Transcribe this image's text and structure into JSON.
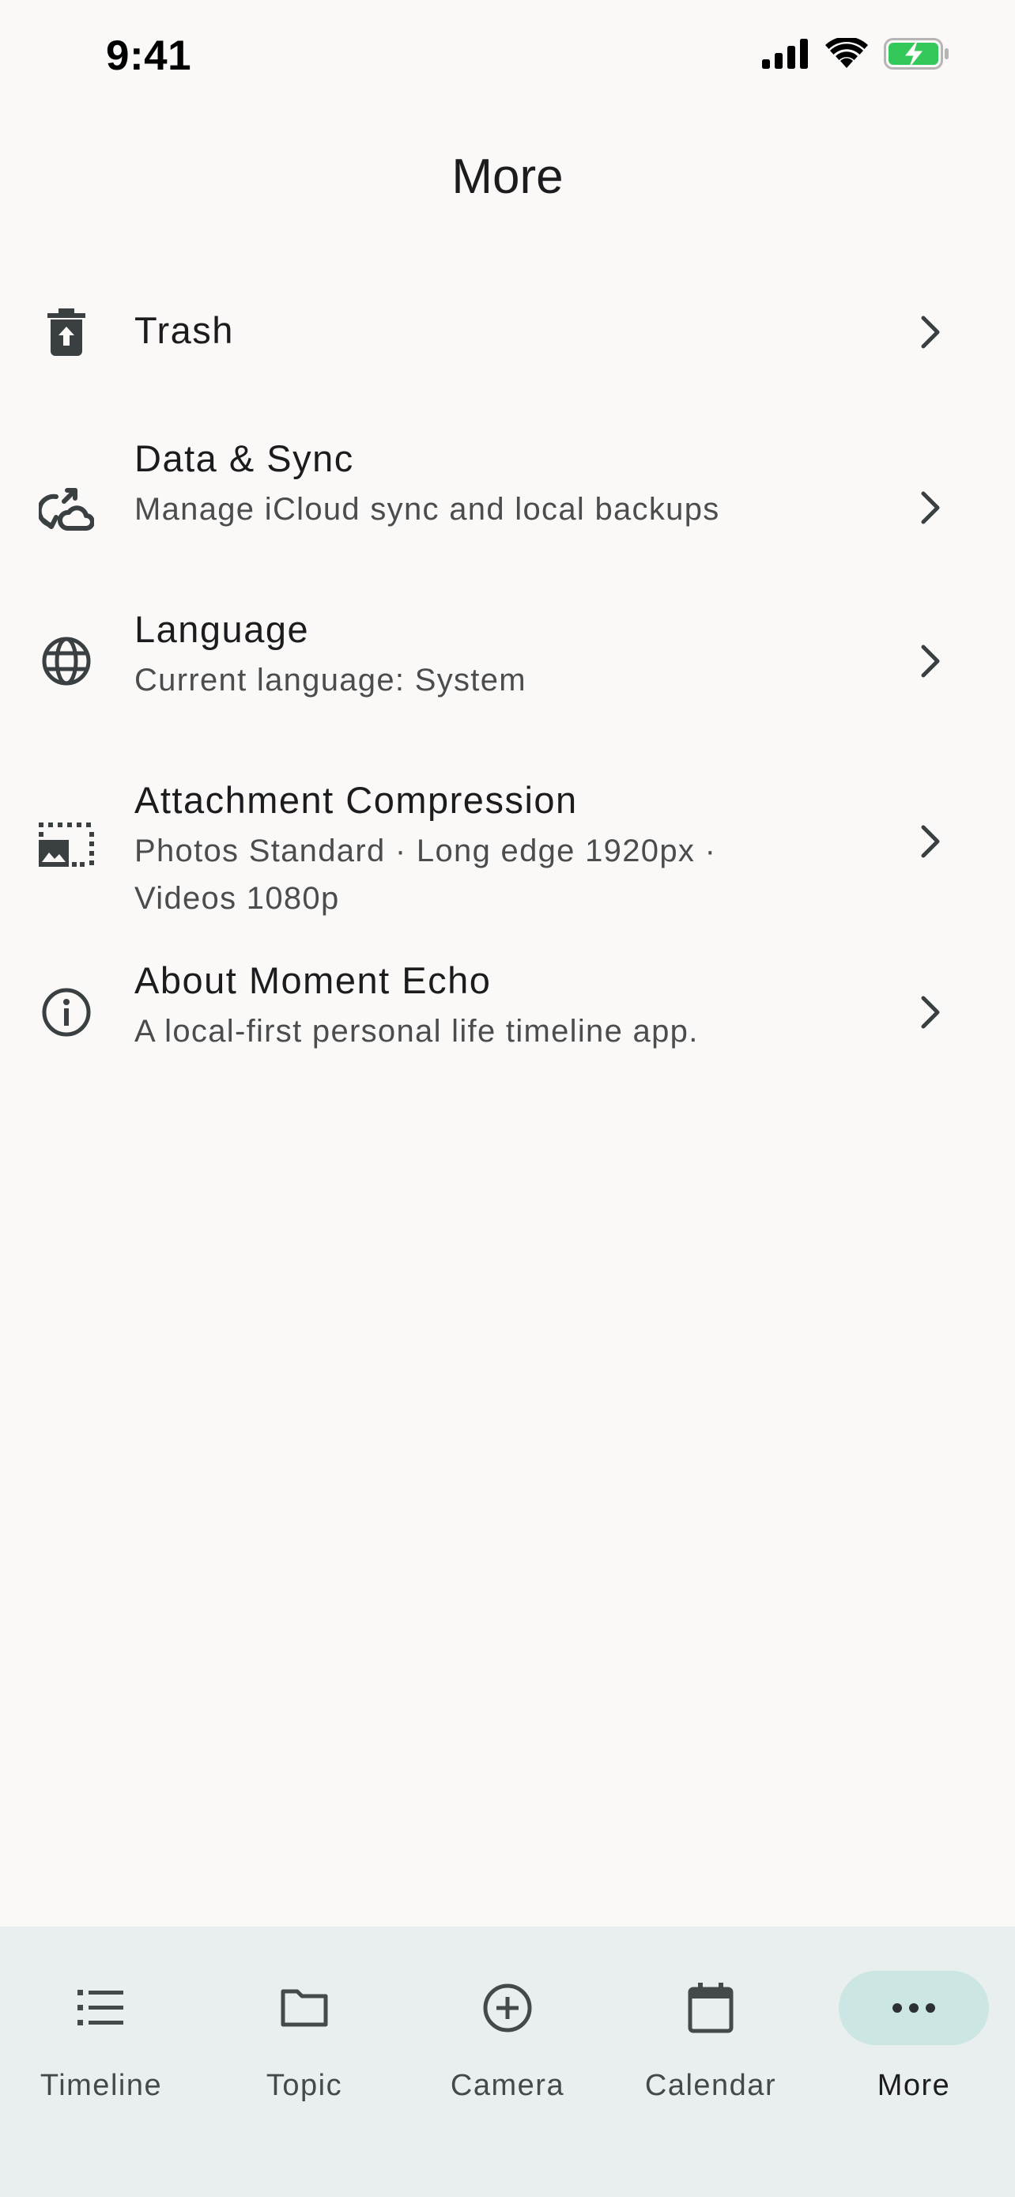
{
  "status_bar": {
    "time": "9:41"
  },
  "header": {
    "title": "More"
  },
  "menu": [
    {
      "title": "Trash",
      "subtitle": "",
      "icon": "trash-restore-icon"
    },
    {
      "title": "Data & Sync",
      "subtitle": "Manage iCloud sync and local backups",
      "icon": "sync-cloud-icon"
    },
    {
      "title": "Language",
      "subtitle": "Current language: System",
      "icon": "globe-icon"
    },
    {
      "title": "Attachment Compression",
      "subtitle": "Photos Standard · Long edge 1920px · Videos 1080p",
      "icon": "photo-size-select-icon"
    },
    {
      "title": "About Moment Echo",
      "subtitle": "A local-first personal life timeline app.",
      "icon": "info-icon"
    }
  ],
  "tabs": [
    {
      "label": "Timeline",
      "icon": "list-icon",
      "active": false
    },
    {
      "label": "Topic",
      "icon": "folder-icon",
      "active": false
    },
    {
      "label": "Camera",
      "icon": "add-circle-icon",
      "active": false
    },
    {
      "label": "Calendar",
      "icon": "calendar-icon",
      "active": false
    },
    {
      "label": "More",
      "icon": "more-horizontal-icon",
      "active": true
    }
  ],
  "colors": {
    "background": "#FAF9F7",
    "tab_bar": "#E9EFEE",
    "active_pill": "#CBE6E3",
    "battery_green": "#34C759"
  }
}
